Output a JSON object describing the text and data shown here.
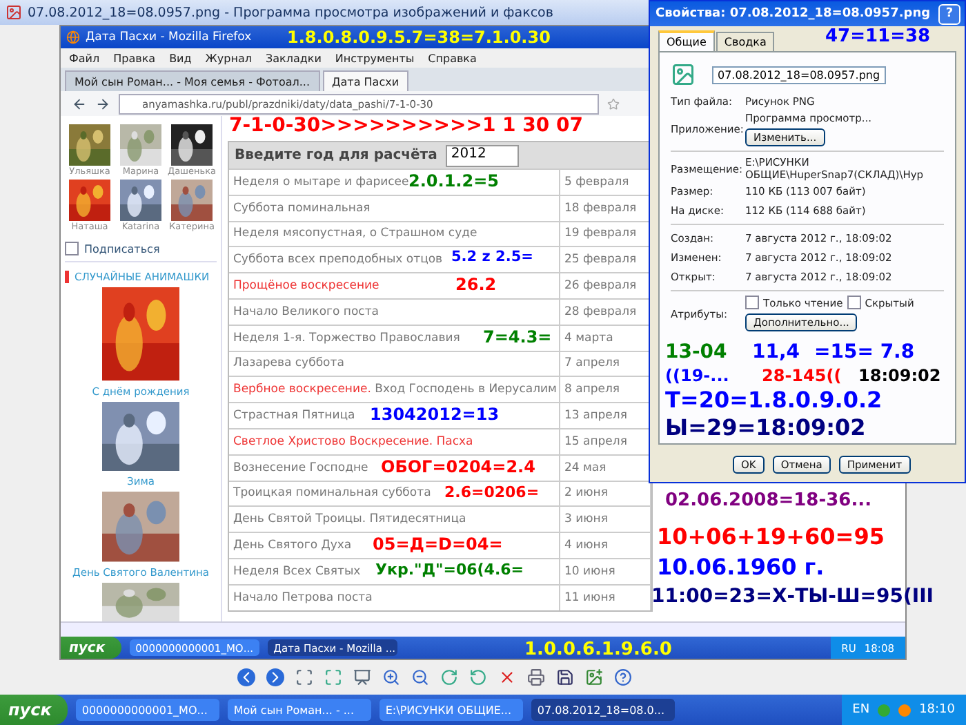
{
  "viewer": {
    "title": "07.08.2012_18=08.0957.png - Программа просмотра изображений и факсов"
  },
  "browser": {
    "title": "Дата Пасхи - Mozilla Firefox",
    "menu": [
      "Файл",
      "Правка",
      "Вид",
      "Журнал",
      "Закладки",
      "Инструменты",
      "Справка"
    ],
    "tabs": [
      {
        "label": "Мой сын Роман... - Моя семья - Фотоал...",
        "selected": false
      },
      {
        "label": "Дата Пасхи",
        "selected": true
      }
    ],
    "url": "anyamashka.ru/publ/prazdniki/daty/data_pashi/7-1-0-30",
    "sidebar": {
      "photos": [
        "Ульяшка",
        "Марина",
        "Дашенька",
        "Наташа",
        "Katarina",
        "Катерина"
      ],
      "subscribe": {
        "label": "Подписаться",
        "checked": false
      },
      "heading": "СЛУЧАЙНЫЕ АНИМАШКИ",
      "cards": [
        "С днём рождения",
        "Зима",
        "День Святого Валентина"
      ]
    },
    "table": {
      "heading": "Введите год для расчёта",
      "year": "2012",
      "rows": [
        {
          "name": "Неделя о мытаре и фарисее",
          "date": "5 февраля",
          "feast": false
        },
        {
          "name": "Суббота поминальная",
          "date": "18 февраля",
          "feast": false
        },
        {
          "name": "Неделя мясопустная, о Страшном суде",
          "date": "19 февраля",
          "feast": false
        },
        {
          "name": "Суббота всех преподобных отцов",
          "date": "25 февраля",
          "feast": false
        },
        {
          "name": "Прощёное воскресение",
          "date": "26 февраля",
          "feast": true
        },
        {
          "name": "Начало Великого поста",
          "date": "28 февраля",
          "feast": false
        },
        {
          "name": "Неделя 1-я. Торжество Православия",
          "date": "4 марта",
          "feast": false
        },
        {
          "name": "Лазарева суббота",
          "date": "7 апреля",
          "feast": false
        },
        {
          "name": "Вербное воскресение.",
          "extra": "Вход Господень в Иерусалим",
          "date": "8 апреля",
          "feast": true
        },
        {
          "name": "Страстная Пятница",
          "date": "13 апреля",
          "feast": false
        },
        {
          "name": "Светлое Христово Воскресение. Пасха",
          "date": "15 апреля",
          "feast": true
        },
        {
          "name": "Вознесение Господне",
          "date": "24 мая",
          "feast": false
        },
        {
          "name": "Троицкая поминальная суббота",
          "date": "2 июня",
          "feast": false
        },
        {
          "name": "День Святой Троицы. Пятидесятница",
          "date": "3 июня",
          "feast": false
        },
        {
          "name": "День Святого Духа",
          "date": "4 июня",
          "feast": false
        },
        {
          "name": "Неделя Всех Святых",
          "date": "10 июня",
          "feast": false
        },
        {
          "name": "Начало Петрова поста",
          "date": "11 июня",
          "feast": false
        }
      ]
    }
  },
  "inner_taskbar": {
    "start": "пуск",
    "tasks": [
      {
        "label": "0000000000001_МО...",
        "selected": false
      },
      {
        "label": "Дата Пасхи - Mozilla ...",
        "selected": true
      }
    ],
    "lang": "RU",
    "clock": "18:08"
  },
  "properties": {
    "title": "Свойства: 07.08.2012_18=08.0957.png",
    "help": "?",
    "tabs": [
      {
        "label": "Общие",
        "selected": true
      },
      {
        "label": "Сводка",
        "selected": false
      }
    ],
    "filename": "07.08.2012_18=08.0957.png",
    "groups": [
      [
        {
          "label": "Тип файла:",
          "value": "Рисунок PNG"
        },
        {
          "label": "Приложение:",
          "value": "Программа просмотр...",
          "button": "Изменить..."
        }
      ],
      [
        {
          "label": "Размещение:",
          "value": "E:\\РИСУНКИ ОБЩИЕ\\HuperSnap7(СКЛАД)\\Hyp"
        },
        {
          "label": "Размер:",
          "value": "110 КБ (113 007 байт)"
        },
        {
          "label": "На диске:",
          "value": "112 КБ (114 688 байт)"
        }
      ],
      [
        {
          "label": "Создан:",
          "value": "7 августа 2012 г., 18:09:02"
        },
        {
          "label": "Изменен:",
          "value": "7 августа 2012 г., 18:09:02"
        },
        {
          "label": "Открыт:",
          "value": "7 августа 2012 г., 18:09:02"
        }
      ]
    ],
    "attributes": {
      "label": "Атрибуты:",
      "items": [
        {
          "label": "Только чтение",
          "checked": false
        },
        {
          "label": "Скрытый",
          "checked": false
        }
      ],
      "button": "Дополнительно..."
    },
    "buttons": [
      "OK",
      "Отмена",
      "Применит"
    ]
  },
  "taskbar": {
    "start": "пуск",
    "tasks": [
      {
        "label": "0000000000001_МО...",
        "selected": false
      },
      {
        "label": "Мой сын Роман... - ...",
        "selected": false
      },
      {
        "label": "E:\\РИСУНКИ ОБЩИЕ...",
        "selected": false
      },
      {
        "label": "07.08.2012_18=08.0...",
        "selected": true
      }
    ],
    "lang": "EN",
    "clock": "18:10"
  },
  "annotations": [
    {
      "text": "1.8.0.8.0.9.5.7=38=7.1.0.30",
      "color": "#ffff00"
    },
    {
      "text": "47=11=38",
      "color": "#0000ff"
    },
    {
      "text": "7-1-0-30>>>>>>>>>>1 1 30 07",
      "color": "#ff0000"
    },
    {
      "text": "2.0.1.2=5",
      "color": "#008000"
    },
    {
      "text": "5.2 z 2.5=",
      "color": "#0000ff"
    },
    {
      "text": "26.2",
      "color": "#ff0000"
    },
    {
      "text": "7=4.3=",
      "color": "#008000"
    },
    {
      "text": "13-04",
      "color": "#008000"
    },
    {
      "text": "11,4",
      "color": "#0000ff"
    },
    {
      "text": "=15= 7.8",
      "color": "#0000ff"
    },
    {
      "text": "((19-...",
      "color": "#0000ff"
    },
    {
      "text": "28-145((",
      "color": "#ff0000"
    },
    {
      "text": "18:09:02",
      "color": "#000000"
    },
    {
      "text": "Т=20=1.8.0.9.0.2",
      "color": "#0000ff"
    },
    {
      "text": "13042012=13",
      "color": "#0000ff"
    },
    {
      "text": "Ы=29=18:09:02",
      "color": "#000080"
    },
    {
      "text": "ОБОГ=0204=2.4",
      "color": "#ff0000"
    },
    {
      "text": "2.6=0206=",
      "color": "#ff0000"
    },
    {
      "text": "02.06.2008=18-36...",
      "color": "#800080"
    },
    {
      "text": "05=Д=D=04=",
      "color": "#ff0000"
    },
    {
      "text": "10+06+19+60=95",
      "color": "#ff0000"
    },
    {
      "text": "Укр.\"Д\"=06(4.6=",
      "color": "#008000"
    },
    {
      "text": "10.06.1960 г.",
      "color": "#0000ff"
    },
    {
      "text": "11:00=23=Х-ТЫ-Ш=95(III",
      "color": "#000080"
    },
    {
      "text": "1.0.0.6.1.9.6.0",
      "color": "#ffff00"
    }
  ]
}
